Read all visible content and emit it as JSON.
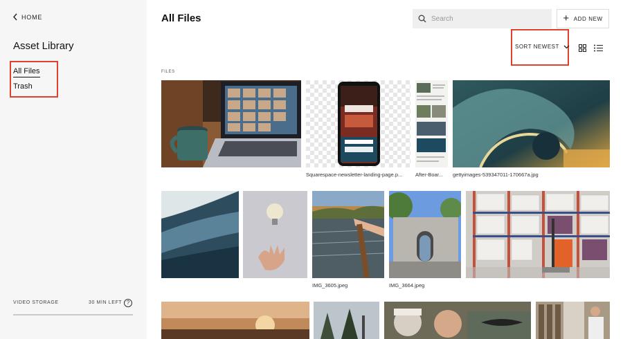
{
  "sidebar": {
    "home_label": "HOME",
    "title": "Asset Library",
    "nav": [
      {
        "label": "All Files",
        "active": true
      },
      {
        "label": "Trash",
        "active": false
      }
    ],
    "storage": {
      "label": "VIDEO STORAGE",
      "remaining": "30 MIN LEFT"
    },
    "help_icon": "?"
  },
  "header": {
    "title": "All Files",
    "search_placeholder": "Search",
    "add_new_label": "ADD NEW",
    "sort_label": "SORT NEWEST"
  },
  "section_label": "FILES",
  "files": [
    {
      "name": "",
      "icon": "laptop-coffee-photo"
    },
    {
      "name": "Squarespace-newsletter-landing-page.p...",
      "icon": "phone-newsletter-photo"
    },
    {
      "name": "After-Boar...",
      "icon": "document-collage-photo"
    },
    {
      "name": "gettyimages-539347011-170667a.jpg",
      "icon": "wave-photo"
    },
    {
      "name": "",
      "icon": "surf-wave-photo"
    },
    {
      "name": "",
      "icon": "lightbulb-hand-photo"
    },
    {
      "name": "IMG_3605.jpeg",
      "icon": "river-fishing-photo"
    },
    {
      "name": "IMG_3664.jpeg",
      "icon": "building-photo"
    },
    {
      "name": "",
      "icon": "warehouse-forklift-photo"
    },
    {
      "name": "",
      "icon": "sunset-photo"
    },
    {
      "name": "",
      "icon": "trees-photo"
    },
    {
      "name": "",
      "icon": "people-photo"
    },
    {
      "name": "",
      "icon": "shop-photo"
    }
  ],
  "colors": {
    "accent_outline": "#e2402f",
    "sidebar_bg": "#f6f6f6",
    "search_bg": "#efefef"
  }
}
